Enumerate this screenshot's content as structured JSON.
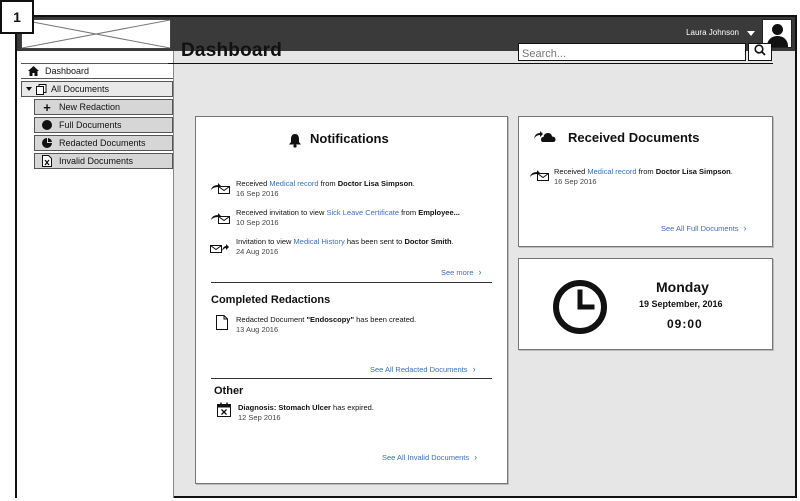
{
  "badge": "1",
  "header": {
    "user_name": "Laura Johnson"
  },
  "sidebar": {
    "items": [
      {
        "label": "Dashboard",
        "icon": "home-icon"
      },
      {
        "label": "All Documents",
        "icon": "documents-icon"
      },
      {
        "label": "New Redaction",
        "icon": "plus-icon"
      },
      {
        "label": "Full Documents",
        "icon": "circle-icon"
      },
      {
        "label": "Redacted Documents",
        "icon": "pie-icon"
      },
      {
        "label": "Invalid Documents",
        "icon": "invalid-document-icon"
      }
    ]
  },
  "page": {
    "title": "Dashboard"
  },
  "search": {
    "placeholder": "Search..."
  },
  "notifications": {
    "title": "Notifications",
    "items": [
      {
        "pre": "Received ",
        "link": "Medical record",
        "mid": " from ",
        "bold": "Doctor Lisa Simpson",
        "post": ".",
        "date": "16 Sep 2016"
      },
      {
        "pre": "Received invitation to view ",
        "link": "Sick Leave Certificate",
        "mid": " from ",
        "bold": "Employee...",
        "post": "",
        "date": "10 Sep 2016"
      },
      {
        "pre": "Invitation to view ",
        "link": "Medical History",
        "mid": " has been sent to ",
        "bold": "Doctor Smith",
        "post": ".",
        "date": "24 Aug 2016"
      }
    ],
    "see_more": "See more",
    "completed": {
      "title": "Completed Redactions",
      "pre": "Redacted Document ",
      "bold": "\"Endoscopy\"",
      "post": " has been created.",
      "date": "13 Aug 2016",
      "see_all": "See All Redacted Documents"
    },
    "other": {
      "title": "Other",
      "bold": "Diagnosis: Stomach Ulcer",
      "post": " has expired.",
      "date": "12 Sep 2016",
      "see_all": "See All Invalid Documents"
    }
  },
  "received": {
    "title": "Received Documents",
    "pre": "Received ",
    "link": "Medical record",
    "mid": " from ",
    "bold": "Doctor Lisa Simpson",
    "post": ".",
    "date": "16 Sep 2016",
    "see_all": "See All Full Documents"
  },
  "clock": {
    "day": "Monday",
    "date": "19 September, 2016",
    "time": "09:00"
  },
  "colors": {
    "topbar": "#3a3a3a",
    "link": "#3b6fc4",
    "canvas": "#e6e6e6"
  }
}
